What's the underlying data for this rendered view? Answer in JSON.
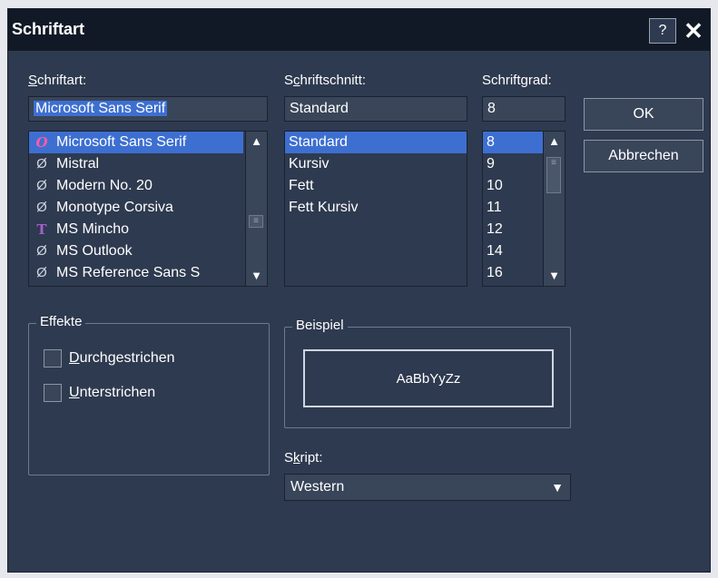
{
  "dialog": {
    "title": "Schriftart",
    "help_label": "?",
    "close_label": "✕"
  },
  "font": {
    "label_prefix": "S",
    "label_rest": "chriftart:",
    "value": "Microsoft Sans Serif",
    "items": [
      {
        "icon": "O",
        "icon_name": "opentype-font-icon",
        "label": "Microsoft Sans Serif"
      },
      {
        "icon": "Ø",
        "icon_name": "printer-font-icon",
        "label": "Mistral"
      },
      {
        "icon": "Ø",
        "icon_name": "printer-font-icon",
        "label": "Modern No. 20"
      },
      {
        "icon": "Ø",
        "icon_name": "printer-font-icon",
        "label": "Monotype Corsiva"
      },
      {
        "icon": "T",
        "icon_name": "truetype-font-icon",
        "label": "MS Mincho"
      },
      {
        "icon": "Ø",
        "icon_name": "printer-font-icon",
        "label": "MS Outlook"
      },
      {
        "icon": "Ø",
        "icon_name": "printer-font-icon",
        "label": "MS Reference Sans S"
      }
    ]
  },
  "style": {
    "label_prefix": "S",
    "label_underline": "c",
    "label_rest": "hriftschnitt:",
    "value": "Standard",
    "items": [
      "Standard",
      "Kursiv",
      "Fett",
      "Fett Kursiv"
    ]
  },
  "size": {
    "label_prefix": "Schrift",
    "label_underline": "g",
    "label_rest": "rad:",
    "value": "8",
    "items": [
      "8",
      "9",
      "10",
      "11",
      "12",
      "14",
      "16"
    ]
  },
  "buttons": {
    "ok": "OK",
    "cancel": "Abbrechen"
  },
  "effects": {
    "title": "Effekte",
    "strike_underline": "D",
    "strike_rest": "urchgestrichen",
    "underline_underline": "U",
    "underline_rest": "nterstrichen"
  },
  "preview": {
    "title": "Beispiel",
    "sample_text": "AaBbYyZz"
  },
  "script": {
    "label_prefix": "S",
    "label_underline": "k",
    "label_rest": "ript:",
    "value": "Western"
  }
}
